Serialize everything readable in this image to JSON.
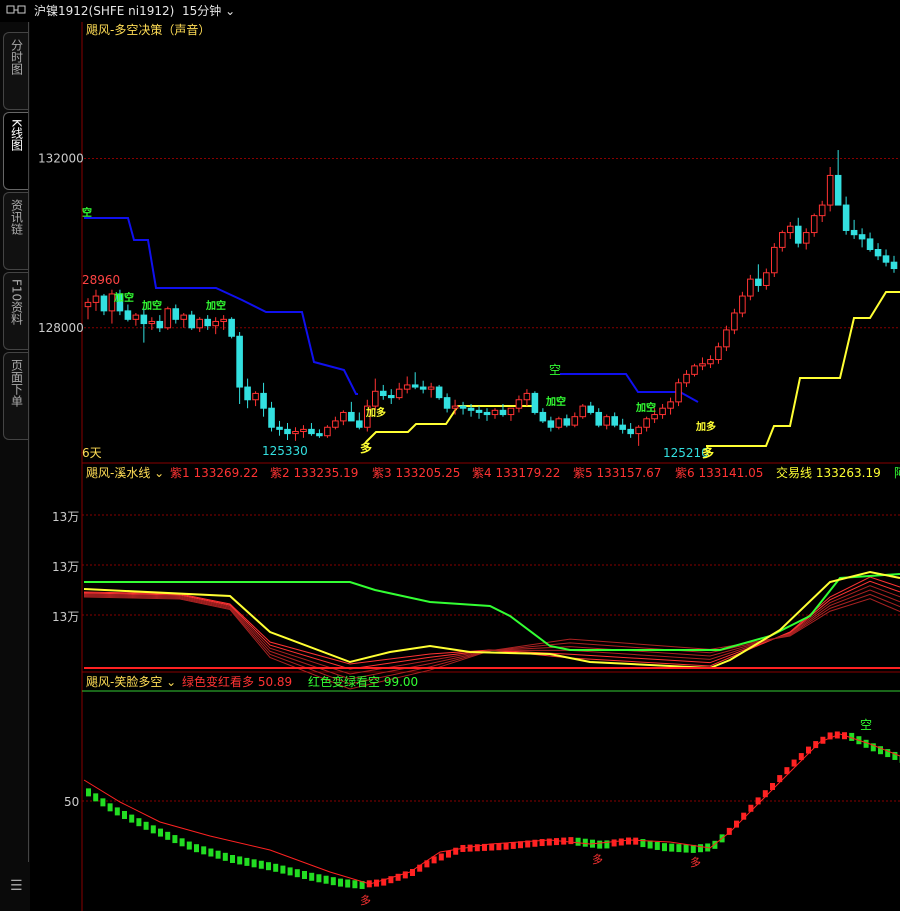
{
  "symbol": {
    "title": "沪镍1912(SHFE ni1912)",
    "period": "15分钟"
  },
  "tabs": [
    "分时图",
    "K线图",
    "资讯链",
    "F10资料",
    "页面下单"
  ],
  "active_tab": 1,
  "colors": {
    "up": "#ff3333",
    "down": "#33e0e0",
    "blue": "#1010ee",
    "yellow": "#ffff33",
    "green": "#33ff33",
    "grid": "#880000"
  },
  "panel1": {
    "title": "飓风-多空决策（声音）",
    "price_labels": [
      {
        "value": 132000,
        "text": "132000"
      },
      {
        "value": 128000,
        "text": "128000"
      }
    ],
    "left_price_text": "28960",
    "low_labels": [
      "125330",
      "125210"
    ],
    "days_text": "6天",
    "signals": {
      "kong": "空",
      "jiakong": "加空",
      "jiaduo": "加多",
      "duo": "多"
    }
  },
  "panel2": {
    "title": "飓风-溪水线",
    "legend": [
      {
        "label": "紫1 133269.22"
      },
      {
        "label": "紫2 133235.19"
      },
      {
        "label": "紫3 133205.25"
      },
      {
        "label": "紫4 133179.22"
      },
      {
        "label": "紫5 133157.67"
      },
      {
        "label": "紫6 133141.05"
      },
      {
        "label": "交易线 133263.19"
      }
    ],
    "legend_trail": "阿",
    "axis_labels": [
      "13万",
      "13万",
      "13万"
    ]
  },
  "panel3": {
    "title": "飓风-笑脸多空",
    "legend": [
      {
        "label": "绿色变红看多 50.89"
      },
      {
        "label": "红色变绿看空 99.00"
      }
    ],
    "axis_label": "50",
    "signals": {
      "kong": "空",
      "duo": "多"
    }
  },
  "chart_data": {
    "type": "candlestick",
    "series": [
      {
        "ohlc": [
          [
            128500,
            128700,
            128200,
            128600
          ],
          [
            128600,
            128900,
            128400,
            128750
          ],
          [
            128750,
            128800,
            128300,
            128400
          ],
          [
            128400,
            128900,
            128100,
            128800
          ],
          [
            128800,
            128900,
            128300,
            128400
          ],
          [
            128400,
            128550,
            128150,
            128200
          ],
          [
            128200,
            128350,
            128050,
            128300
          ],
          [
            128300,
            128450,
            127650,
            128100
          ],
          [
            128100,
            128250,
            127950,
            128150
          ],
          [
            128150,
            128300,
            127900,
            128000
          ],
          [
            128000,
            128500,
            127950,
            128450
          ],
          [
            128450,
            128550,
            128100,
            128200
          ],
          [
            128200,
            128350,
            128000,
            128300
          ],
          [
            128300,
            128400,
            127950,
            128000
          ],
          [
            128000,
            128250,
            127900,
            128200
          ],
          [
            128200,
            128300,
            127950,
            128050
          ],
          [
            128050,
            128250,
            127850,
            128150
          ],
          [
            128150,
            128300,
            127950,
            128200
          ],
          [
            128200,
            128250,
            127750,
            127800
          ],
          [
            127800,
            127900,
            126200,
            126600
          ],
          [
            126600,
            126800,
            126100,
            126300
          ],
          [
            126300,
            126500,
            126150,
            126450
          ],
          [
            126450,
            126700,
            125900,
            126100
          ],
          [
            126100,
            126250,
            125550,
            125650
          ],
          [
            125650,
            125800,
            125450,
            125600
          ],
          [
            125600,
            125750,
            125350,
            125500
          ],
          [
            125500,
            125650,
            125330,
            125550
          ],
          [
            125550,
            125700,
            125400,
            125600
          ],
          [
            125600,
            125750,
            125450,
            125500
          ],
          [
            125500,
            125600,
            125400,
            125450
          ],
          [
            125450,
            125700,
            125400,
            125650
          ],
          [
            125650,
            125900,
            125600,
            125800
          ],
          [
            125800,
            126050,
            125700,
            126000
          ],
          [
            126000,
            126250,
            125900,
            125800
          ],
          [
            125800,
            126000,
            125600,
            125650
          ],
          [
            125650,
            126300,
            125550,
            126150
          ],
          [
            126150,
            126800,
            126050,
            126500
          ],
          [
            126500,
            126650,
            126300,
            126400
          ],
          [
            126400,
            126550,
            126200,
            126350
          ],
          [
            126350,
            126700,
            126300,
            126550
          ],
          [
            126550,
            126850,
            126450,
            126650
          ],
          [
            126650,
            126950,
            126550,
            126600
          ],
          [
            126600,
            126750,
            126450,
            126550
          ],
          [
            126550,
            126700,
            126350,
            126600
          ],
          [
            126600,
            126650,
            126300,
            126350
          ],
          [
            126350,
            126450,
            126000,
            126100
          ],
          [
            126100,
            126300,
            125950,
            126150
          ],
          [
            126150,
            126250,
            125950,
            126100
          ],
          [
            126100,
            126200,
            125900,
            126050
          ],
          [
            126050,
            126150,
            125850,
            126000
          ],
          [
            126000,
            126100,
            125800,
            125950
          ],
          [
            125950,
            126100,
            125850,
            126050
          ],
          [
            126050,
            126200,
            125900,
            125950
          ],
          [
            125950,
            126100,
            125800,
            126100
          ],
          [
            126100,
            126400,
            126000,
            126300
          ],
          [
            126300,
            126550,
            126150,
            126450
          ],
          [
            126450,
            126500,
            125950,
            126000
          ],
          [
            126000,
            126100,
            125750,
            125800
          ],
          [
            125800,
            125900,
            125550,
            125650
          ],
          [
            125650,
            125900,
            125600,
            125850
          ],
          [
            125850,
            125950,
            125650,
            125700
          ],
          [
            125700,
            126000,
            125650,
            125900
          ],
          [
            125900,
            126200,
            125850,
            126150
          ],
          [
            126150,
            126250,
            125950,
            126000
          ],
          [
            126000,
            126100,
            125650,
            125700
          ],
          [
            125700,
            125950,
            125600,
            125900
          ],
          [
            125900,
            126000,
            125650,
            125700
          ],
          [
            125700,
            125850,
            125500,
            125600
          ],
          [
            125600,
            125750,
            125400,
            125500
          ],
          [
            125500,
            125700,
            125210,
            125650
          ],
          [
            125650,
            125900,
            125550,
            125850
          ],
          [
            125850,
            126100,
            125750,
            125950
          ],
          [
            125950,
            126200,
            125850,
            126100
          ],
          [
            126100,
            126350,
            125950,
            126250
          ],
          [
            126250,
            126800,
            126150,
            126700
          ],
          [
            126700,
            127000,
            126600,
            126900
          ],
          [
            126900,
            127150,
            126850,
            127100
          ],
          [
            127100,
            127300,
            127000,
            127150
          ],
          [
            127150,
            127350,
            127050,
            127250
          ],
          [
            127250,
            127650,
            127150,
            127550
          ],
          [
            127550,
            128050,
            127450,
            127950
          ],
          [
            127950,
            128450,
            127850,
            128350
          ],
          [
            128350,
            128850,
            128250,
            128750
          ],
          [
            128750,
            129250,
            128650,
            129150
          ],
          [
            129150,
            129500,
            128850,
            129000
          ],
          [
            129000,
            129400,
            128900,
            129300
          ],
          [
            129300,
            130000,
            129200,
            129900
          ],
          [
            129900,
            130300,
            129800,
            130250
          ],
          [
            130250,
            130500,
            130100,
            130400
          ],
          [
            130400,
            130600,
            129900,
            130000
          ],
          [
            130000,
            130350,
            129850,
            130250
          ],
          [
            130250,
            130700,
            130150,
            130650
          ],
          [
            130650,
            131000,
            130500,
            130900
          ],
          [
            130900,
            131800,
            130750,
            131600
          ],
          [
            131600,
            132200,
            131400,
            130900
          ],
          [
            130900,
            131100,
            130200,
            130300
          ],
          [
            130300,
            130550,
            130100,
            130200
          ],
          [
            130200,
            130350,
            129900,
            130100
          ],
          [
            130100,
            130250,
            129800,
            129850
          ],
          [
            129850,
            130000,
            129600,
            129700
          ],
          [
            129700,
            129850,
            129450,
            129550
          ],
          [
            129550,
            129700,
            129300,
            129400
          ]
        ]
      }
    ],
    "ylim": [
      124900,
      134800
    ]
  }
}
